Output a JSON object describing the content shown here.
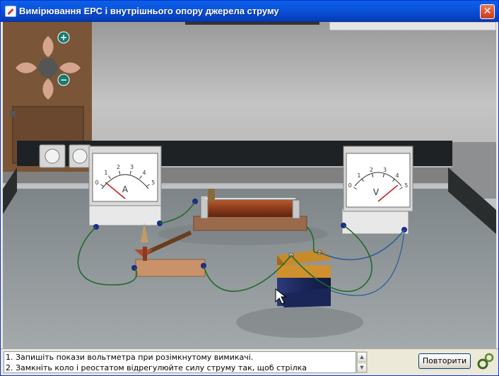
{
  "window": {
    "title": "Вимірювання ЕРС і внутрішнього опору джерела струму",
    "close_glyph": "✕"
  },
  "scene": {
    "ammeter_unit": "A",
    "voltmeter_unit": "V",
    "scale_ticks": [
      "0",
      "1",
      "2",
      "3",
      "4",
      "5"
    ],
    "ammeter_reading_fraction": 0.08,
    "voltmeter_reading_fraction": 0.92,
    "colors": {
      "table_top": "#8a9294",
      "table_edge": "#2a2d2e",
      "wall": "#c9c9c9",
      "door": "#7a5538",
      "wire_green": "#1f6a2c",
      "wire_blue": "#2a5f9a",
      "battery_top": "#c98a2a",
      "battery_body": "#1d2a63",
      "rheostat_coil": "#8d3b1c",
      "needle": "#d01010"
    },
    "icons": {
      "scene_nav": "navigation-cross-icon",
      "zoom_in": "zoom-in-icon",
      "zoom_out": "zoom-out-icon",
      "cursor": "mouse-pointer-icon",
      "settings": "gear-icon"
    }
  },
  "instructions": {
    "lines": [
      "1. Запишіть покази вольтметра при розімкнутому вимикачі.",
      "2. Замкніть коло і реостатом відрегулюйте силу струму так, щоб стрілка"
    ]
  },
  "controls": {
    "repeat_label": "Повторити",
    "scroll_up_glyph": "▲",
    "scroll_down_glyph": "▼"
  }
}
